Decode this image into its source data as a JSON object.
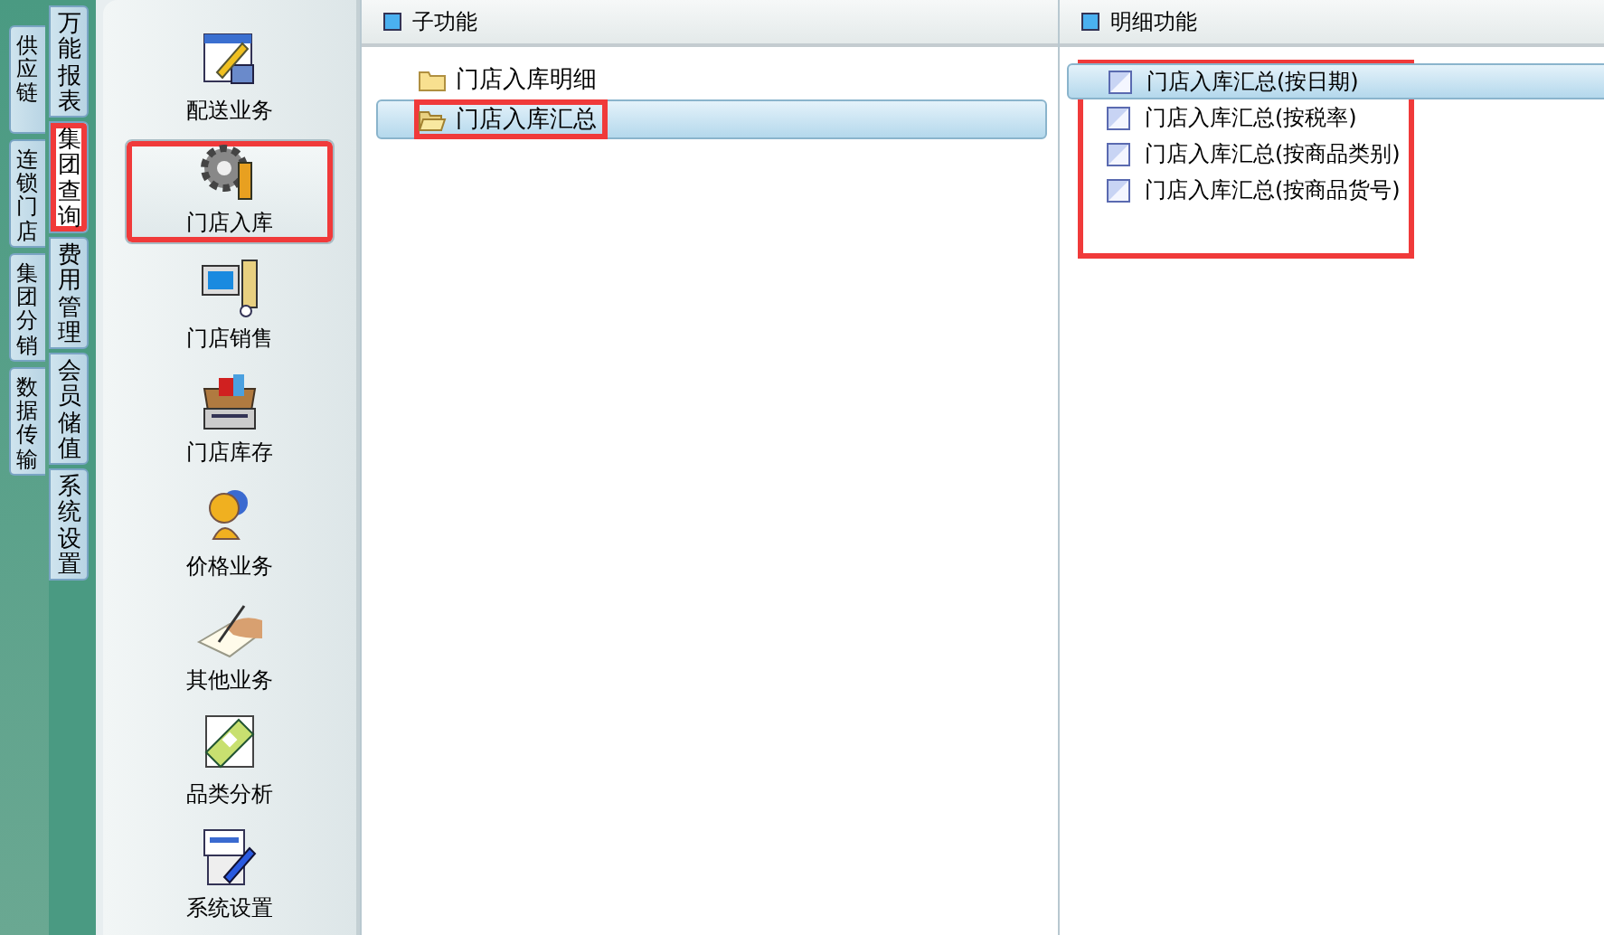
{
  "outer_tabs": [
    {
      "label": "供应链",
      "selected": false
    },
    {
      "label": "连锁门店",
      "selected": false
    },
    {
      "label": "集团分销",
      "selected": false
    },
    {
      "label": "数据传输",
      "selected": false
    }
  ],
  "inner_tabs": [
    {
      "label": "万能报表",
      "selected": false,
      "annotated": false
    },
    {
      "label": "集团查询",
      "selected": true,
      "annotated": true
    },
    {
      "label": "费用管理",
      "selected": false,
      "annotated": false
    },
    {
      "label": "会员储值",
      "selected": false,
      "annotated": false
    },
    {
      "label": "系统设置",
      "selected": false,
      "annotated": false
    }
  ],
  "nav": [
    {
      "label": "配送业务",
      "kind": "form",
      "selected": false,
      "annotated": false
    },
    {
      "label": "门店入库",
      "kind": "gear",
      "selected": true,
      "annotated": true
    },
    {
      "label": "门店销售",
      "kind": "computer",
      "selected": false,
      "annotated": false
    },
    {
      "label": "门店库存",
      "kind": "box",
      "selected": false,
      "annotated": false
    },
    {
      "label": "价格业务",
      "kind": "people",
      "selected": false,
      "annotated": false
    },
    {
      "label": "其他业务",
      "kind": "hand",
      "selected": false,
      "annotated": false
    },
    {
      "label": "品类分析",
      "kind": "money",
      "selected": false,
      "annotated": false
    },
    {
      "label": "系统设置",
      "kind": "sheet",
      "selected": false,
      "annotated": false
    }
  ],
  "sub_panel": {
    "title": "子功能",
    "items": [
      {
        "label": "门店入库明细",
        "selected": false,
        "annotated": false
      },
      {
        "label": "门店入库汇总",
        "selected": true,
        "annotated": true
      }
    ]
  },
  "detail_panel": {
    "title": "明细功能",
    "annotated": true,
    "items": [
      {
        "label": "门店入库汇总(按日期)",
        "selected": true
      },
      {
        "label": "门店入库汇总(按税率)",
        "selected": false
      },
      {
        "label": "门店入库汇总(按商品类别)",
        "selected": false
      },
      {
        "label": "门店入库汇总(按商品货号)",
        "selected": false
      }
    ]
  }
}
